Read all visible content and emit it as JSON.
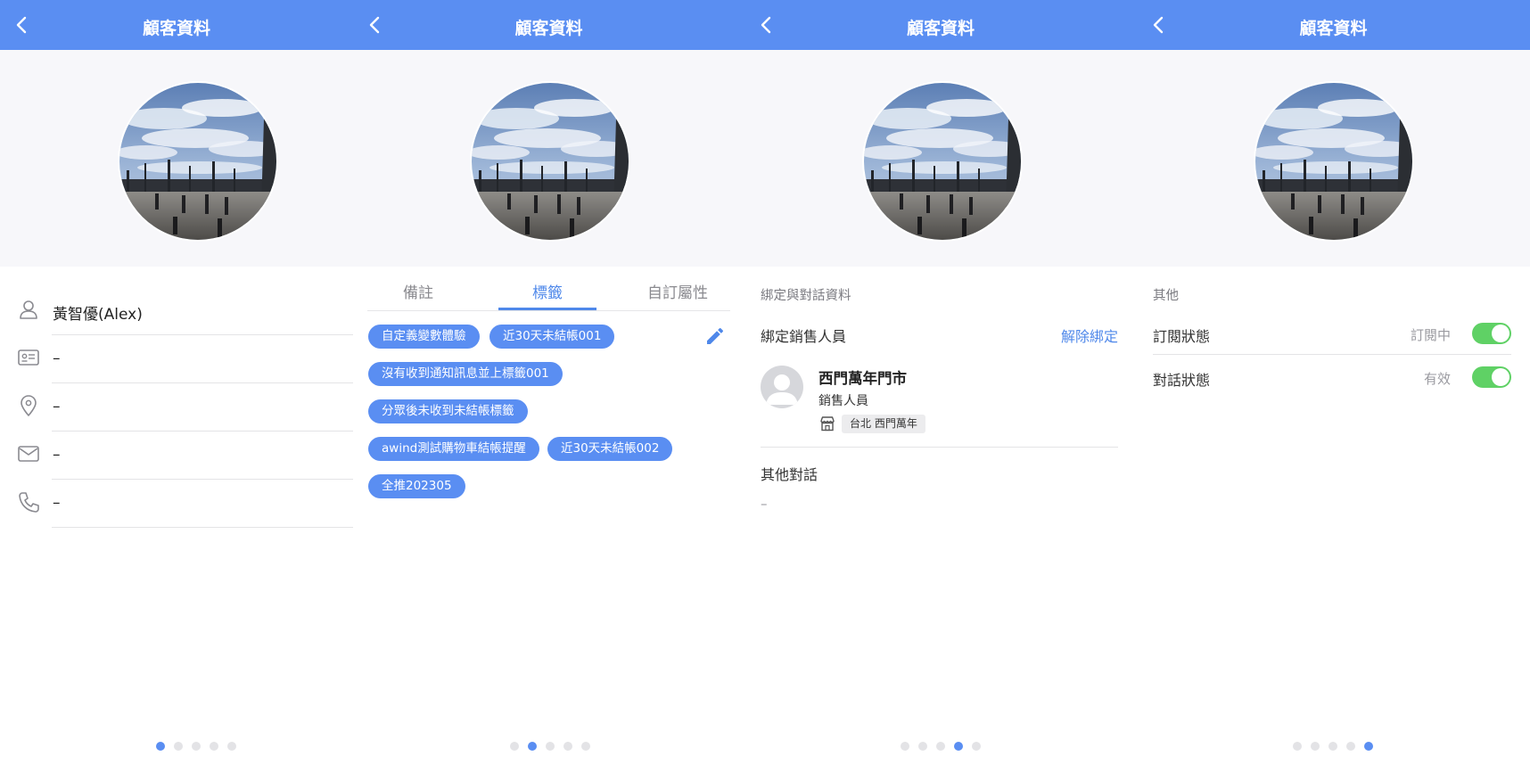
{
  "header": {
    "title": "顧客資料"
  },
  "accent_color": "#5a8ef2",
  "toggle_color": "#5fd165",
  "pager": {
    "count": 5
  },
  "panel1": {
    "name": "黃智優(Alex)",
    "id_value": "–",
    "address_value": "–",
    "email_value": "–",
    "phone_value": "–",
    "active_dot": 1
  },
  "panel2": {
    "tabs": [
      {
        "label": "備註"
      },
      {
        "label": "標籤"
      },
      {
        "label": "自訂屬性"
      }
    ],
    "active_tab": 2,
    "tags": [
      "自定義變數體驗",
      "近30天未結帳001",
      "沒有收到通知訊息並上標籤001",
      "分眾後未收到未結帳標籤",
      "awind測試購物車結帳提醒",
      "近30天未結帳002",
      "全推202305"
    ],
    "active_dot": 2
  },
  "panel3": {
    "section_title": "綁定與對話資料",
    "bind_label": "綁定銷售人員",
    "unbind_label": "解除綁定",
    "store_name": "西門萬年門市",
    "role": "銷售人員",
    "location": "台北 西門萬年",
    "other_title": "其他對話",
    "other_value": "–",
    "active_dot": 4
  },
  "panel4": {
    "section_title": "其他",
    "subscribe_label": "訂閱狀態",
    "subscribe_state": "訂閱中",
    "subscribe_on": true,
    "chat_label": "對話狀態",
    "chat_state": "有效",
    "chat_on": true,
    "active_dot": 5
  }
}
